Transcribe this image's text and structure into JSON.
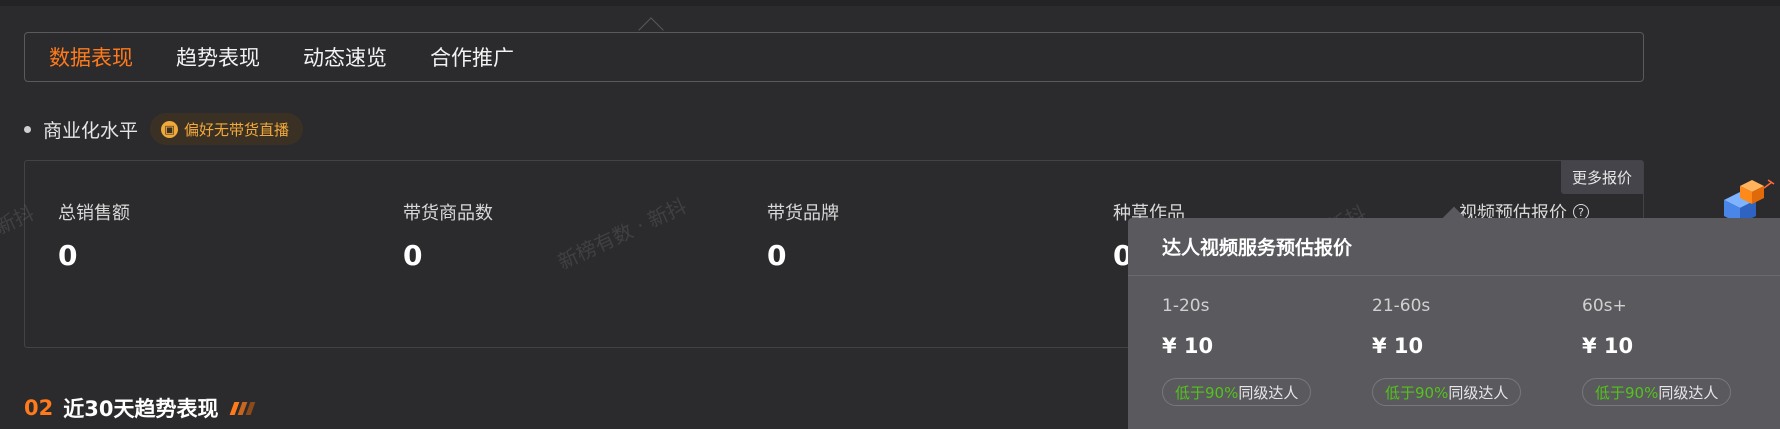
{
  "tabs": [
    {
      "label": "数据表现",
      "active": true
    },
    {
      "label": "趋势表现",
      "active": false
    },
    {
      "label": "动态速览",
      "active": false
    },
    {
      "label": "合作推广",
      "active": false
    }
  ],
  "section": {
    "title": "商业化水平",
    "badge": "偏好无带货直播"
  },
  "card": {
    "more_quote": "更多报价",
    "stats": [
      {
        "label": "总销售额",
        "value": "0"
      },
      {
        "label": "带货商品数",
        "value": "0"
      },
      {
        "label": "带货品牌",
        "value": "0"
      },
      {
        "label": "种草作品",
        "value": "0"
      },
      {
        "label": "视频预估报价",
        "value": ""
      }
    ]
  },
  "watermarks": [
    "新榜有数 · 新抖",
    "新抖",
    "新抖"
  ],
  "trend": {
    "num": "02",
    "title": "近30天趋势表现"
  },
  "popover": {
    "title": "达人视频服务预估报价",
    "items": [
      {
        "duration": "1-20s",
        "price": "¥ 10",
        "tag_highlight": "低于90%",
        "tag_rest": "同级达人"
      },
      {
        "duration": "21-60s",
        "price": "¥ 10",
        "tag_highlight": "低于90%",
        "tag_rest": "同级达人"
      },
      {
        "duration": "60s+",
        "price": "¥ 10",
        "tag_highlight": "低于90%",
        "tag_rest": "同级达人"
      }
    ]
  },
  "colors": {
    "accent": "#ff7a1a",
    "badge_text": "#f2a93b",
    "green": "#52c41a"
  }
}
